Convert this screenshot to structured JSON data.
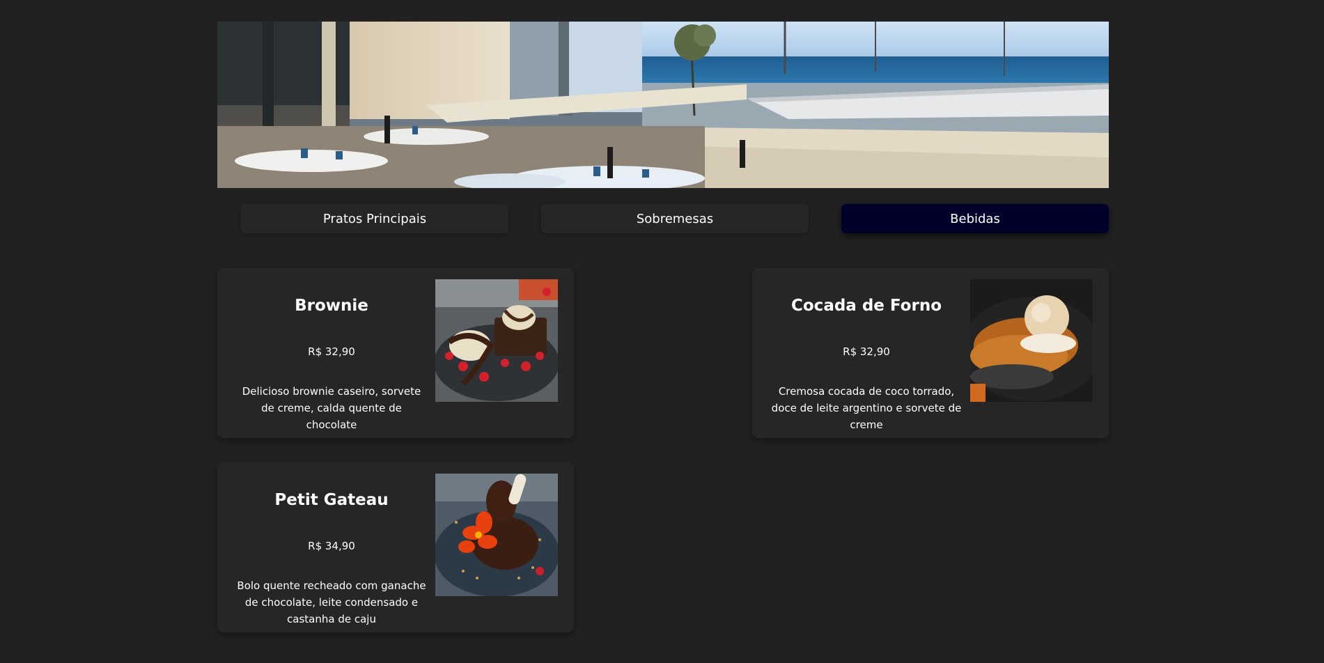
{
  "hero": {
    "icon": "restaurant-terrace-photo"
  },
  "tabs": [
    {
      "label": "Pratos Principais",
      "active": false
    },
    {
      "label": "Sobremesas",
      "active": false
    },
    {
      "label": "Bebidas",
      "active": true
    }
  ],
  "colors": {
    "background": "#212121",
    "card": "#262626",
    "active_tab": "#01002a"
  },
  "items": [
    {
      "name": "Brownie",
      "price": "R$ 32,90",
      "description": "Delicioso brownie caseiro, sorvete de creme, calda quente de chocolate",
      "icon": "brownie-photo"
    },
    {
      "name": "Cocada de Forno",
      "price": "R$ 32,90",
      "description": "Cremosa cocada de coco torrado, doce de leite argentino e sorvete de creme",
      "icon": "cocada-photo"
    },
    {
      "name": "Petit Gateau",
      "price": "R$ 34,90",
      "description": "Bolo quente recheado com ganache de chocolate, leite condensado e castanha de caju",
      "icon": "petit-gateau-photo"
    }
  ]
}
